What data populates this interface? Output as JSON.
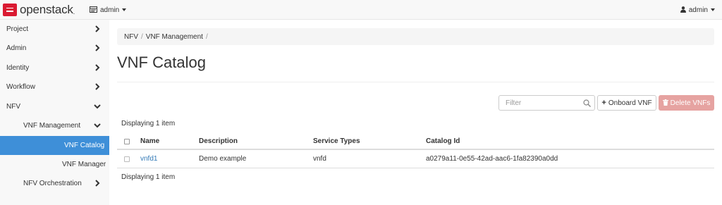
{
  "navbar": {
    "logo_text": "openstack",
    "logo_tm": ".",
    "project_label": "admin",
    "user_label": "admin"
  },
  "sidebar": {
    "items": [
      {
        "label": "Project",
        "chevron": "right"
      },
      {
        "label": "Admin",
        "chevron": "right"
      },
      {
        "label": "Identity",
        "chevron": "right"
      },
      {
        "label": "Workflow",
        "chevron": "right"
      },
      {
        "label": "NFV",
        "chevron": "down"
      },
      {
        "label": "VNF Management",
        "chevron": "down"
      },
      {
        "label": "VNF Catalog",
        "active": true
      },
      {
        "label": "VNF Manager"
      },
      {
        "label": "NFV Orchestration",
        "chevron": "right"
      }
    ],
    "active_color": "#3e8fd8"
  },
  "breadcrumb": [
    "NFV",
    "VNF Management"
  ],
  "page_title": "VNF Catalog",
  "toolbar": {
    "filter_placeholder": "Filter",
    "onboard_label": "Onboard VNF",
    "delete_label": "Delete VNFs",
    "delete_color": "#e6a3a1"
  },
  "table": {
    "count_top": "Displaying 1 item",
    "count_bottom": "Displaying 1 item",
    "columns": [
      "Name",
      "Description",
      "Service Types",
      "Catalog Id"
    ],
    "rows": [
      {
        "name": "vnfd1",
        "description": "Demo example",
        "service_types": "vnfd",
        "catalog_id": "a0279a11-0e55-42ad-aac6-1fa82390a0dd"
      }
    ]
  }
}
